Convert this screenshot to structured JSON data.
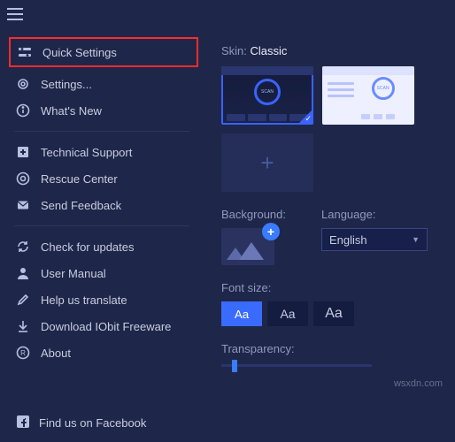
{
  "sidebar": {
    "quick_settings": "Quick Settings",
    "settings": "Settings...",
    "whats_new": "What's New",
    "technical_support": "Technical Support",
    "rescue_center": "Rescue Center",
    "send_feedback": "Send Feedback",
    "check_updates": "Check for updates",
    "user_manual": "User Manual",
    "help_translate": "Help us translate",
    "download_freeware": "Download IObit Freeware",
    "about": "About"
  },
  "footer": {
    "facebook": "Find us on Facebook"
  },
  "main": {
    "skin_label": "Skin:",
    "skin_value": "Classic",
    "scan_label_1": "SCAN",
    "scan_label_2": "SCAN",
    "add_thumb": "+",
    "background_label": "Background:",
    "language_label": "Language:",
    "language_value": "English",
    "font_size_label": "Font size:",
    "font_aa": "Aa",
    "transparency_label": "Transparency:"
  },
  "watermark": "wsxdn.com"
}
